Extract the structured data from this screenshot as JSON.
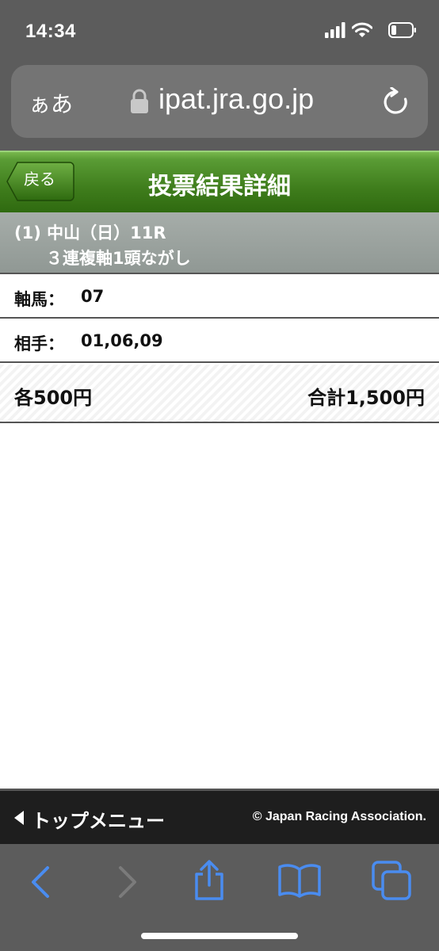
{
  "status_bar": {
    "time": "14:34"
  },
  "url_bar": {
    "text_size_label": "ぁあ",
    "domain": "ipat.jra.go.jp"
  },
  "header": {
    "back_label": "戻る",
    "title": "投票結果詳細"
  },
  "race": {
    "line1": "(1) 中山（日）11R",
    "line2": "３連複軸1頭ながし"
  },
  "rows": [
    {
      "label": "軸馬：",
      "value": "07"
    },
    {
      "label": "相手：",
      "value": "01,06,09"
    }
  ],
  "totals": {
    "each": "各500円",
    "total": "合計1,500円"
  },
  "footer": {
    "top_menu_label": "トップメニュー",
    "copyright": "© Japan Racing Association."
  },
  "colors": {
    "header_green": "#3f7d1c",
    "toolbar_gray": "#5c5c5c",
    "toolbar_accent": "#4a8cf0"
  }
}
